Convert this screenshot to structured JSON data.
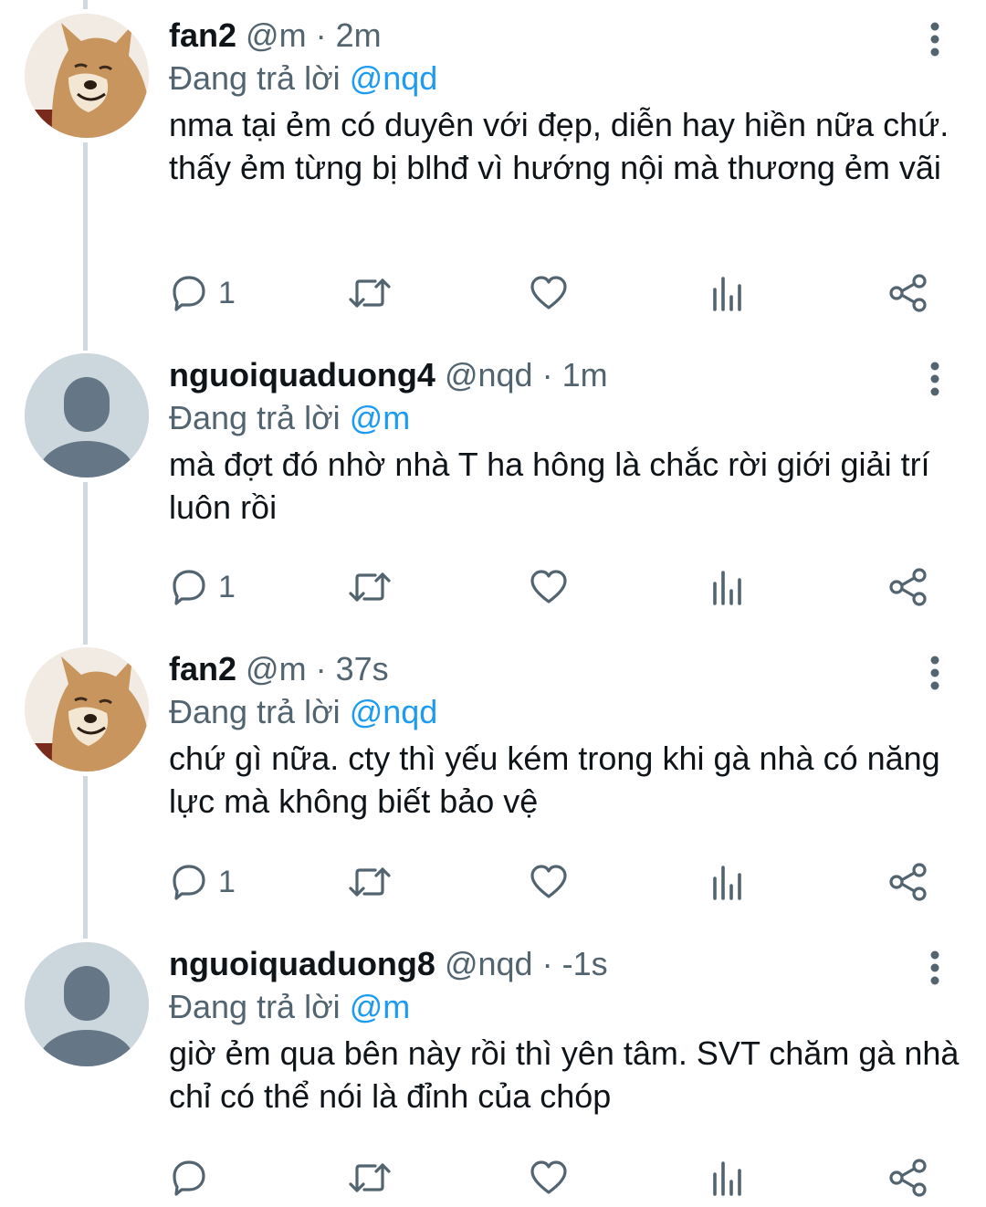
{
  "tweets": [
    {
      "display_name": "fan2",
      "handle": "@m",
      "separator": "·",
      "time": "2m",
      "reply_prefix": "Đang trả lời",
      "reply_to": "@nqd",
      "text": "nma tại ẻm có duyên với đẹp, diễn hay hiền nữa chứ. thấy ẻm từng bị blhđ vì hướng nội mà thương ẻm vãi",
      "reply_count": "1",
      "avatar": "shiba-dog-photo"
    },
    {
      "display_name": "nguoiquaduong4",
      "handle": "@nqd",
      "separator": "·",
      "time": "1m",
      "reply_prefix": "Đang trả lời",
      "reply_to": "@m",
      "text": "mà đợt đó nhờ nhà T ha hông là chắc rời giới giải trí luôn rồi",
      "reply_count": "1",
      "avatar": "default-profile-silhouette"
    },
    {
      "display_name": "fan2",
      "handle": "@m",
      "separator": "·",
      "time": "37s",
      "reply_prefix": "Đang trả lời",
      "reply_to": "@nqd",
      "text": "chứ gì nữa. cty thì yếu kém trong khi gà nhà có năng lực mà không biết bảo vệ",
      "reply_count": "1",
      "avatar": "shiba-dog-photo"
    },
    {
      "display_name": "nguoiquaduong8",
      "handle": "@nqd",
      "separator": "·",
      "time": "-1s",
      "reply_prefix": "Đang trả lời",
      "reply_to": "@m",
      "text": "giờ ẻm qua bên này rồi thì yên tâm. SVT chăm gà nhà chỉ có thể nói là đỉnh của chóp",
      "reply_count": "",
      "avatar": "default-profile-silhouette"
    }
  ],
  "icons": {
    "reply": "reply-bubble-icon",
    "retweet": "retweet-icon",
    "like": "heart-icon",
    "views": "analytics-icon",
    "share": "share-icon",
    "more": "more-vertical-icon"
  },
  "colors": {
    "text": "#0f1419",
    "secondary": "#536471",
    "accent": "#1d9bf0",
    "thread_line": "#cfd9de",
    "default_avatar_bg": "#ccd6dd",
    "default_avatar_fg": "#657786"
  }
}
